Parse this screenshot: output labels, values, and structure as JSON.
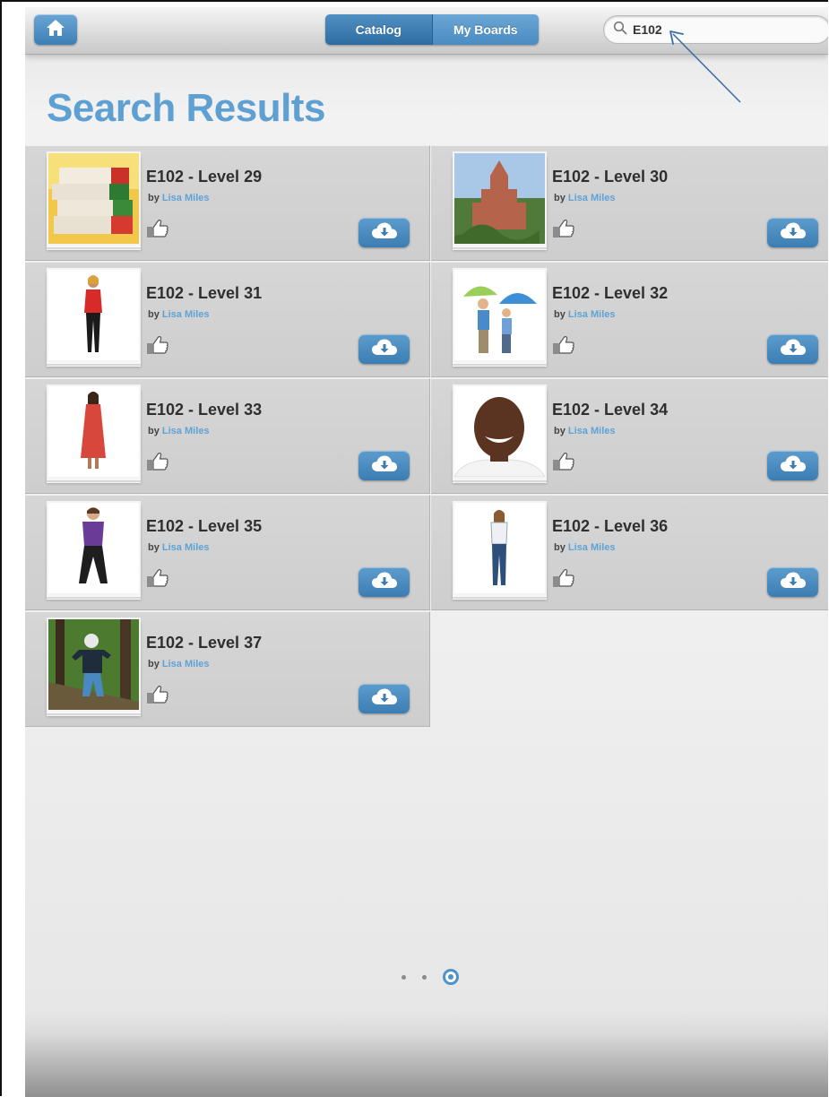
{
  "topbar": {
    "tabs": [
      {
        "label": "Catalog",
        "active": true
      },
      {
        "label": "My Boards",
        "active": false
      }
    ],
    "search_value": "E102"
  },
  "page_title": "Search Results",
  "results": [
    {
      "title": "E102 - Level 29",
      "by": "by",
      "author": "Lisa Miles",
      "image": "binders"
    },
    {
      "title": "E102 - Level 30",
      "by": "by",
      "author": "Lisa Miles",
      "image": "temple"
    },
    {
      "title": "E102 - Level 31",
      "by": "by",
      "author": "Lisa Miles",
      "image": "woman-red-top"
    },
    {
      "title": "E102 - Level 32",
      "by": "by",
      "author": "Lisa Miles",
      "image": "kids-umbrellas"
    },
    {
      "title": "E102 - Level 33",
      "by": "by",
      "author": "Lisa Miles",
      "image": "woman-red-dress"
    },
    {
      "title": "E102 - Level 34",
      "by": "by",
      "author": "Lisa Miles",
      "image": "smiling-man"
    },
    {
      "title": "E102 - Level 35",
      "by": "by",
      "author": "Lisa Miles",
      "image": "boy-purple-shirt"
    },
    {
      "title": "E102 - Level 36",
      "by": "by",
      "author": "Lisa Miles",
      "image": "girl-jeans"
    },
    {
      "title": "E102 - Level 37",
      "by": "by",
      "author": "Lisa Miles",
      "image": "child-outdoors"
    }
  ],
  "pager": {
    "pages": 3,
    "current": 3
  },
  "colors": {
    "accent": "#5fa0d3",
    "button": "#3c7db3",
    "author": "#5ea3d6"
  }
}
